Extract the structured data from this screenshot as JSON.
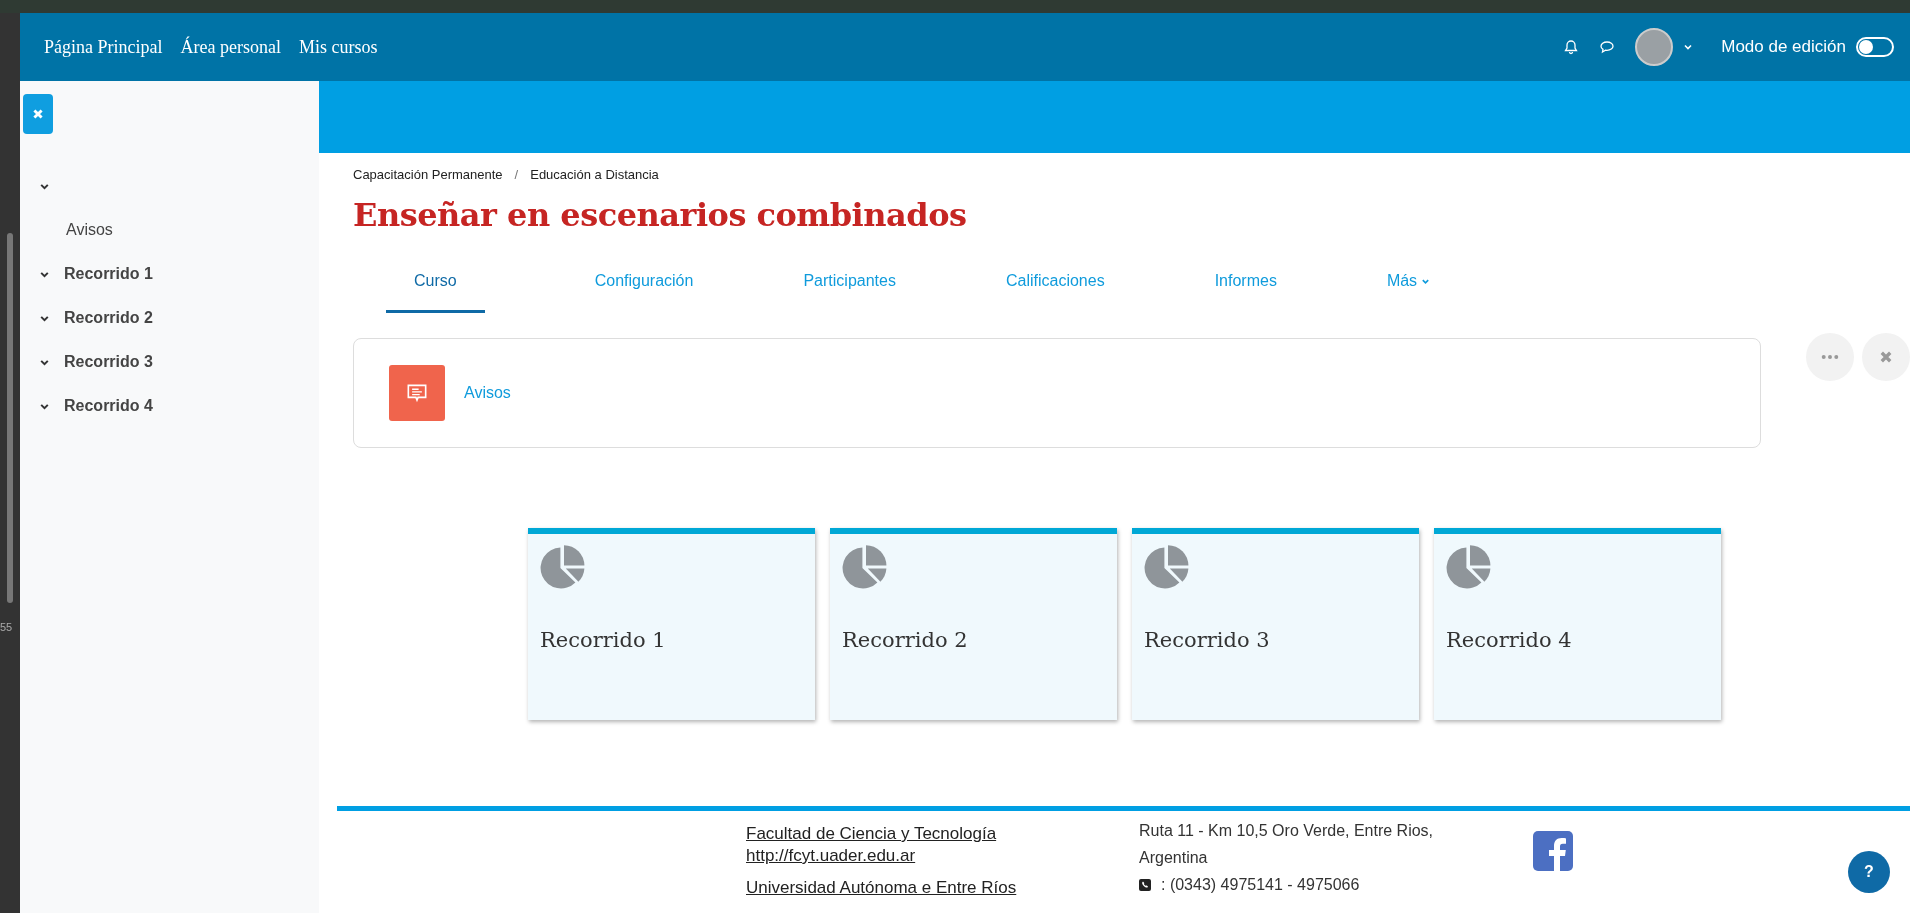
{
  "navbar": {
    "links": [
      {
        "label": "Página Principal"
      },
      {
        "label": "Área personal"
      },
      {
        "label": "Mis cursos"
      }
    ],
    "edit_mode": {
      "label": "Modo de edición",
      "on": false
    }
  },
  "edge_label": "55",
  "sidebar": {
    "sections": [
      {
        "expanded": true,
        "children": [
          {
            "label": "Avisos"
          }
        ]
      },
      {
        "label": "Recorrido 1",
        "expanded": true
      },
      {
        "label": "Recorrido 2",
        "expanded": true
      },
      {
        "label": "Recorrido 3",
        "expanded": true
      },
      {
        "label": "Recorrido 4",
        "expanded": true
      }
    ]
  },
  "breadcrumb": {
    "separator": "/",
    "items": [
      "Capacitación Permanente",
      "Educación a Distancia"
    ]
  },
  "title": "Enseñar en escenarios combinados",
  "tabs": [
    {
      "label": "Curso",
      "selected": true,
      "dropdown": false
    },
    {
      "label": "Configuración",
      "selected": false,
      "dropdown": false
    },
    {
      "label": "Participantes",
      "selected": false,
      "dropdown": false
    },
    {
      "label": "Calificaciones",
      "selected": false,
      "dropdown": false
    },
    {
      "label": "Informes",
      "selected": false,
      "dropdown": false
    },
    {
      "label": "Más",
      "selected": false,
      "dropdown": true
    }
  ],
  "announcement": {
    "label": "Avisos"
  },
  "sections": [
    {
      "label": "Recorrido 1"
    },
    {
      "label": "Recorrido 2"
    },
    {
      "label": "Recorrido 3"
    },
    {
      "label": "Recorrido 4"
    }
  ],
  "footer": {
    "links": [
      "Facultad de Ciencia y Tecnología",
      "http://fcyt.uader.edu.ar",
      "Universidad Autónoma e Entre Ríos"
    ],
    "address": "Ruta 11 - Km 10,5 Oro Verde, Entre Rios, Argentina",
    "phone": ": (0343) 4975141 - 4975066",
    "help": "?"
  }
}
